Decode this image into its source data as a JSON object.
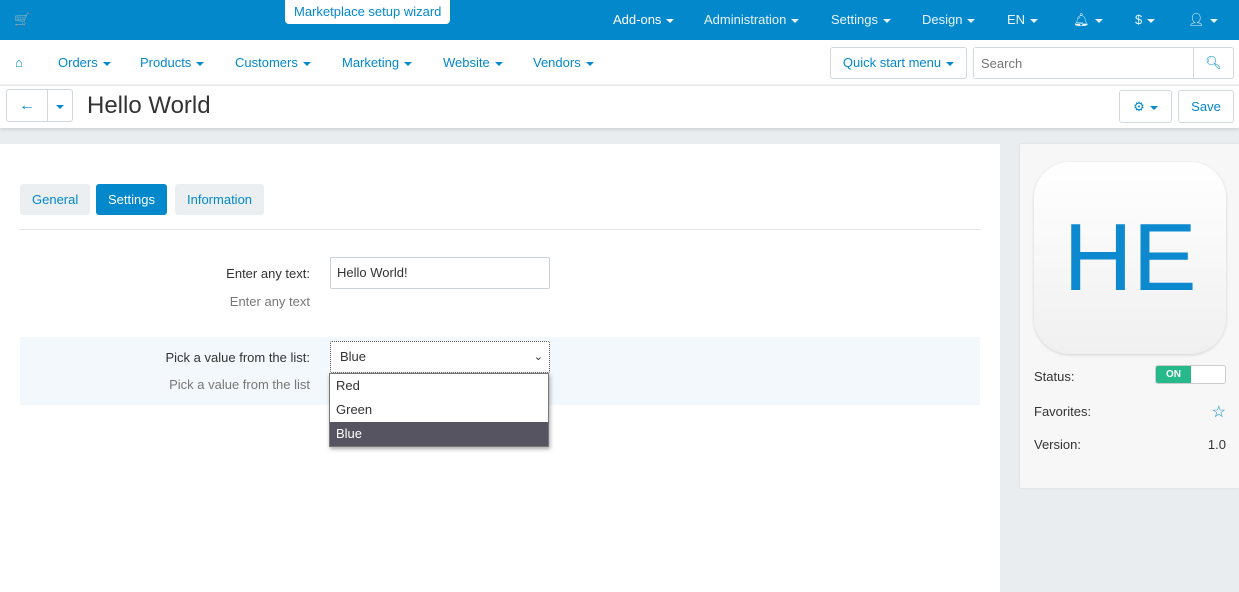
{
  "topbar": {
    "wizard": "Marketplace setup wizard",
    "items": [
      "Add-ons",
      "Administration",
      "Settings",
      "Design",
      "EN",
      "",
      "$",
      ""
    ]
  },
  "nav": {
    "items": [
      "Orders",
      "Products",
      "Customers",
      "Marketing",
      "Website",
      "Vendors"
    ],
    "quick_start": "Quick start menu",
    "search_placeholder": "Search"
  },
  "page": {
    "title": "Hello World",
    "save": "Save"
  },
  "tabs": [
    "General",
    "Settings",
    "Information"
  ],
  "form": {
    "text_label": "Enter any text:",
    "text_value": "Hello World!",
    "text_hint": "Enter any text",
    "list_label": "Pick a value from the list:",
    "list_value": "Blue",
    "list_hint": "Pick a value from the list",
    "options": [
      "Red",
      "Green",
      "Blue"
    ]
  },
  "sidebar": {
    "logo": "HE",
    "status_label": "Status:",
    "status_value": "ON",
    "favorites_label": "Favorites:",
    "version_label": "Version:",
    "version_value": "1.0"
  },
  "colors": {
    "accent": "#0388cc",
    "toggle_on": "#27b98a"
  }
}
